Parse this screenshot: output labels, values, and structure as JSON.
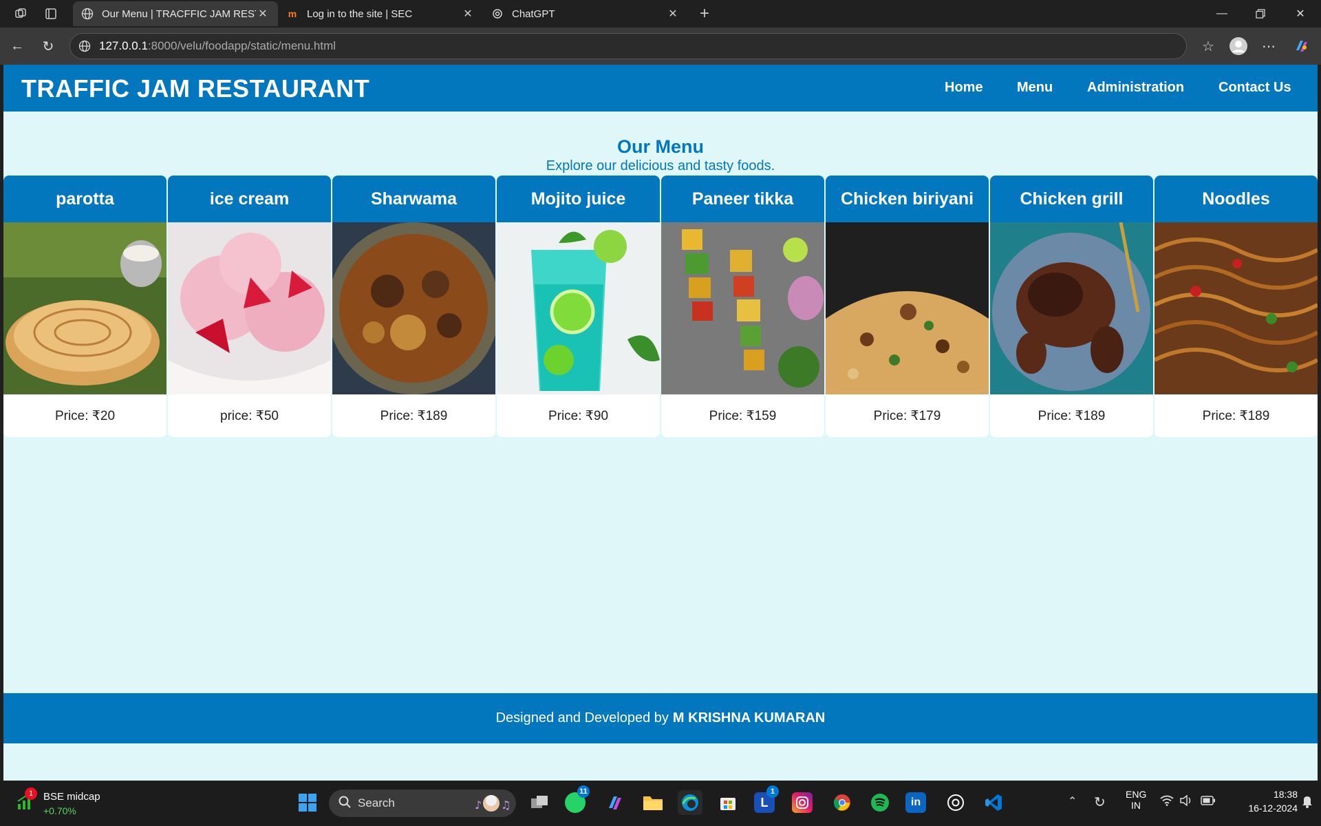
{
  "browser": {
    "tabs": [
      {
        "title": "Our Menu | TRACFFIC JAM RESTA",
        "icon": "globe-icon"
      },
      {
        "title": "Log in to the site | SEC",
        "icon": "moodle-icon"
      },
      {
        "title": "ChatGPT",
        "icon": "chatgpt-icon"
      }
    ],
    "url_host": "127.0.0.1",
    "url_path": ":8000/velu/foodapp/static/menu.html"
  },
  "site": {
    "brand": "TRAFFIC JAM RESTAURANT",
    "nav": [
      "Home",
      "Menu",
      "Administration",
      "Contact Us"
    ],
    "heading": "Our Menu",
    "subheading": "Explore our delicious and tasty foods.",
    "items": [
      {
        "name": "parotta",
        "price": "Price: ₹20",
        "image": "parotta-photo"
      },
      {
        "name": "ice cream",
        "price": "price: ₹50",
        "image": "ice-cream-photo"
      },
      {
        "name": "Sharwama",
        "price": "Price: ₹189",
        "image": "curry-photo"
      },
      {
        "name": "Mojito juice",
        "price": "Price: ₹90",
        "image": "mojito-photo"
      },
      {
        "name": "Paneer tikka",
        "price": "Price: ₹159",
        "image": "paneer-tikka-photo"
      },
      {
        "name": "Chicken biriyani",
        "price": "Price: ₹179",
        "image": "biriyani-photo"
      },
      {
        "name": "Chicken grill",
        "price": "Price: ₹189",
        "image": "chicken-grill-photo"
      },
      {
        "name": "Noodles",
        "price": "Price: ₹189",
        "image": "noodles-photo"
      }
    ],
    "footer_text": "Designed and Developed by",
    "footer_name": "M KRISHNA KUMARAN"
  },
  "taskbar": {
    "stock_name": "BSE midcap",
    "stock_change": "+0.70%",
    "stock_badge": "1",
    "search_label": "Search",
    "whatsapp_badge": "11",
    "l_badge": "1",
    "lang_top": "ENG",
    "lang_bottom": "IN",
    "time": "18:38",
    "date": "16-12-2024"
  },
  "colors": {
    "brand_blue": "#0277bd",
    "page_bg": "#e0f7fa"
  }
}
